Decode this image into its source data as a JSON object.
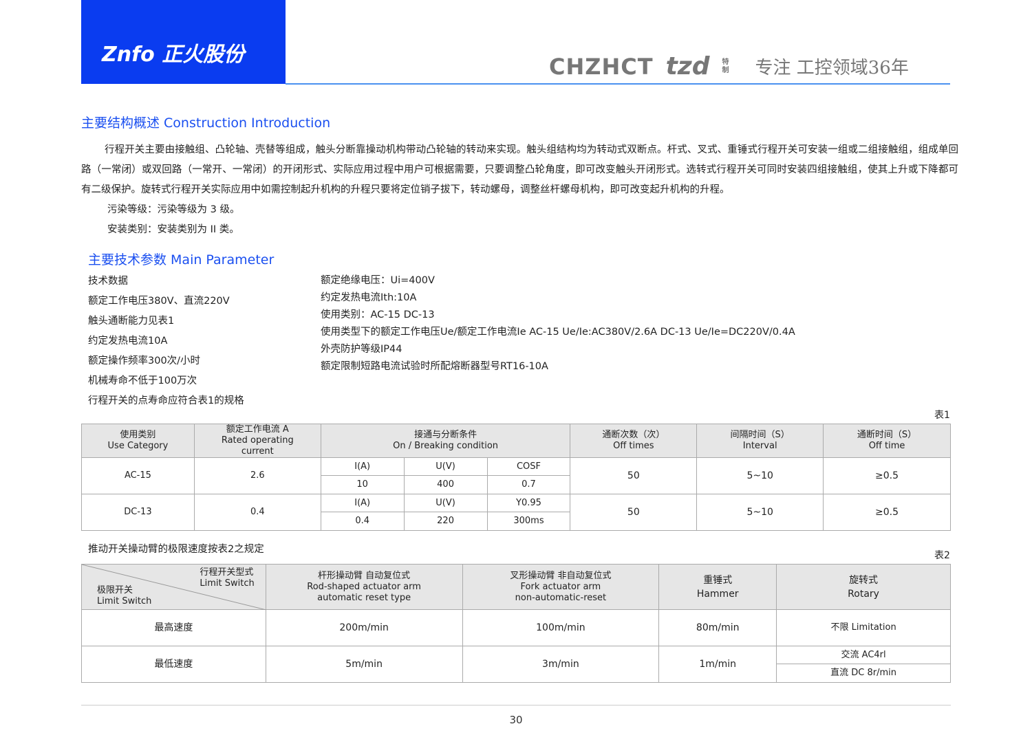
{
  "header": {
    "logo": "Znfo 正火股份",
    "brand1": "CHZHCT",
    "brand2": "tzd",
    "brand2_sub": "特制",
    "slogan": "专注 工控领域36年",
    "accent": "#0a3cf0"
  },
  "section1": {
    "title": "主要结构概述 Construction Introduction",
    "paragraph": "行程开关主要由接触组、凸轮轴、壳替等组成，触头分断靠操动机构带动凸轮轴的转动来实现。触头组结构均为转动式双断点。杆式、叉式、重锤式行程开关可安装一组或二组接触组，组成单回路（一常闭）或双回路（一常开、一常闭）的开闭形式、实际应用过程中用户可根据需要，只要调整凸轮角度，即可改变触头开闭形式。选转式行程开关可同时安装四组接触组，使其上升或下降都可有二级保护。旋转式行程开关实际应用中如需控制起升机构的升程只要将定位销子拔下，转动螺母，调整丝杆螺母机构，即可改变起升机构的升程。",
    "pollution": "污染等级：污染等级为 3 级。",
    "install": "安装类别：安装类别为 II 类。"
  },
  "section2": {
    "title": "主要技术参数 Main Parameter",
    "left": [
      "技术数据",
      "额定工作电压380V、直流220V",
      "触头通断能力见表1",
      "约定发热电流10A",
      "额定操作频率300次/小时",
      "机械寿命不低于100万次",
      "行程开关的点寿命应符合表1的规格"
    ],
    "right": [
      "额定绝缘电压：Ui=400V",
      "约定发热电流Ith:10A",
      "使用类别：AC-15  DC-13",
      "使用类型下的额定工作电压Ue/额定工作电流Ie AC-15  Ue/Ie:AC380V/2.6A DC-13 Ue/Ie=DC220V/0.4A",
      "外壳防护等级IP44",
      "额定限制短路电流试验时所配熔断器型号RT16-10A"
    ]
  },
  "table1": {
    "caption": "表1",
    "headers": [
      "使用类别\nUse Category",
      "额定工作电流 A\nRated operating\ncurrent",
      "接通与分断条件\nOn / Breaking condition",
      "通断次数（次）\nOff times",
      "间隔时间（S）\nInterval",
      "通断时间（S）\nOff time"
    ],
    "rows": [
      {
        "cat": "AC-15",
        "cur": "2.6",
        "sub": [
          [
            "I(A)",
            "U(V)",
            "COSF"
          ],
          [
            "10",
            "400",
            "0.7"
          ]
        ],
        "times": "50",
        "interval": "5~10",
        "off": "≥0.5"
      },
      {
        "cat": "DC-13",
        "cur": "0.4",
        "sub": [
          [
            "I(A)",
            "U(V)",
            "Y0.95"
          ],
          [
            "0.4",
            "220",
            "300ms"
          ]
        ],
        "times": "50",
        "interval": "5~10",
        "off": "≥0.5"
      }
    ]
  },
  "table2": {
    "intro": "推动开关操动臂的极限速度按表2之规定",
    "caption": "表2",
    "corner_top": "行程开关型式\nLimit Switch",
    "corner_bottom": "极限开关\nLimit Switch",
    "headers": [
      "杆形操动臂 自动复位式\nRod-shaped actuator arm\nautomatic reset type",
      "叉形操动臂 非自动复位式\nFork actuator arm\nnon-automatic-reset",
      "重锤式\nHammer",
      "旋转式\nRotary"
    ],
    "rows": [
      {
        "label": "最高速度",
        "vals": [
          "200m/min",
          "100m/min",
          "80m/min",
          "不限 Limitation"
        ]
      },
      {
        "label": "最低速度",
        "vals": [
          "5m/min",
          "3m/min",
          "1m/min"
        ],
        "rotary": [
          "交流 AC4rl",
          "直流 DC 8r/min"
        ]
      }
    ]
  },
  "page_number": "30"
}
